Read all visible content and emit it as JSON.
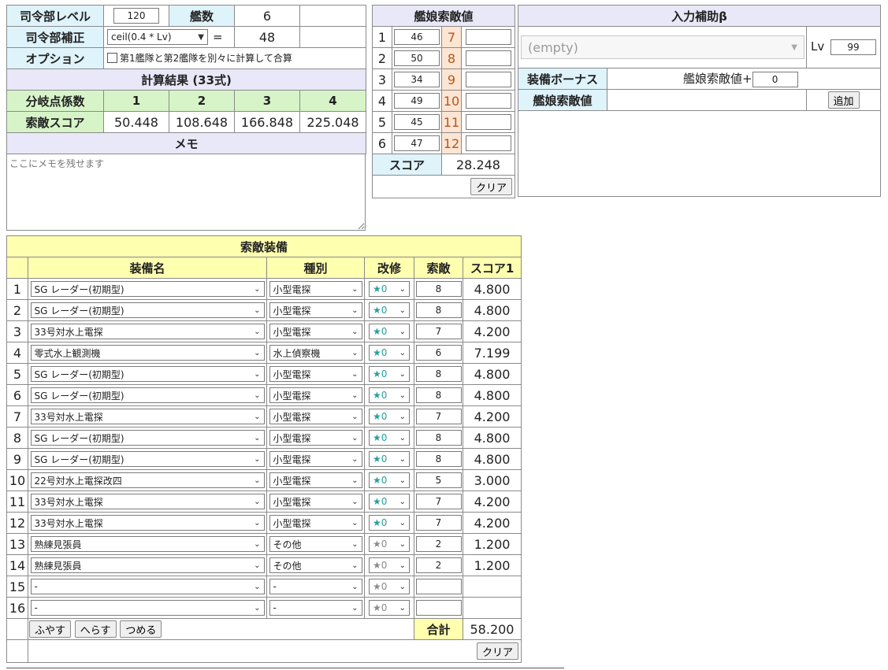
{
  "hq": {
    "level_label": "司令部レベル",
    "level_value": "120",
    "ship_count_label": "艦数",
    "ship_count_value": "6",
    "correction_label": "司令部補正",
    "correction_formula": "ceil(0.4 * Lv)",
    "equals": "=",
    "correction_value": "48",
    "option_label": "オプション",
    "option_text": "第1艦隊と第2艦隊を別々に計算して合算",
    "result_header": "計算結果 (33式)",
    "branch_label": "分岐点係数",
    "branch_values": [
      "1",
      "2",
      "3",
      "4"
    ],
    "score_label": "索敵スコア",
    "score_values": [
      "50.448",
      "108.648",
      "166.848",
      "225.048"
    ],
    "memo_header": "メモ",
    "memo_placeholder": "ここにメモを残せます"
  },
  "ship_los": {
    "header": "艦娘索敵値",
    "left": [
      {
        "n": "1",
        "v": "46"
      },
      {
        "n": "2",
        "v": "50"
      },
      {
        "n": "3",
        "v": "34"
      },
      {
        "n": "4",
        "v": "49"
      },
      {
        "n": "5",
        "v": "45"
      },
      {
        "n": "6",
        "v": "47"
      }
    ],
    "right": [
      {
        "n": "7",
        "v": ""
      },
      {
        "n": "8",
        "v": ""
      },
      {
        "n": "9",
        "v": ""
      },
      {
        "n": "10",
        "v": ""
      },
      {
        "n": "11",
        "v": ""
      },
      {
        "n": "12",
        "v": ""
      }
    ],
    "score_label": "スコア",
    "score_value": "28.248",
    "clear_label": "クリア"
  },
  "assist": {
    "header": "入力補助β",
    "select_value": "(empty)",
    "lv_label": "Lv",
    "lv_value": "99",
    "bonus_label": "装備ボーナス",
    "bonus_text": "艦娘索敵値+",
    "bonus_value": "0",
    "los_label": "艦娘索敵値",
    "add_label": "追加"
  },
  "equip": {
    "header": "索敵装備",
    "columns": [
      "装備名",
      "種別",
      "改修",
      "索敵",
      "スコア1"
    ],
    "rows": [
      {
        "n": "1",
        "name": "SG レーダー(初期型)",
        "type": "小型電探",
        "imp": "★0",
        "on": true,
        "los": "8",
        "score": "4.800"
      },
      {
        "n": "2",
        "name": "SG レーダー(初期型)",
        "type": "小型電探",
        "imp": "★0",
        "on": true,
        "los": "8",
        "score": "4.800"
      },
      {
        "n": "3",
        "name": "33号対水上電探",
        "type": "小型電探",
        "imp": "★0",
        "on": true,
        "los": "7",
        "score": "4.200"
      },
      {
        "n": "4",
        "name": "零式水上観測機",
        "type": "水上偵察機",
        "imp": "★0",
        "on": true,
        "los": "6",
        "score": "7.199"
      },
      {
        "n": "5",
        "name": "SG レーダー(初期型)",
        "type": "小型電探",
        "imp": "★0",
        "on": true,
        "los": "8",
        "score": "4.800"
      },
      {
        "n": "6",
        "name": "SG レーダー(初期型)",
        "type": "小型電探",
        "imp": "★0",
        "on": true,
        "los": "8",
        "score": "4.800"
      },
      {
        "n": "7",
        "name": "33号対水上電探",
        "type": "小型電探",
        "imp": "★0",
        "on": true,
        "los": "7",
        "score": "4.200"
      },
      {
        "n": "8",
        "name": "SG レーダー(初期型)",
        "type": "小型電探",
        "imp": "★0",
        "on": true,
        "los": "8",
        "score": "4.800"
      },
      {
        "n": "9",
        "name": "SG レーダー(初期型)",
        "type": "小型電探",
        "imp": "★0",
        "on": true,
        "los": "8",
        "score": "4.800"
      },
      {
        "n": "10",
        "name": "22号対水上電探改四",
        "type": "小型電探",
        "imp": "★0",
        "on": true,
        "los": "5",
        "score": "3.000"
      },
      {
        "n": "11",
        "name": "33号対水上電探",
        "type": "小型電探",
        "imp": "★0",
        "on": true,
        "los": "7",
        "score": "4.200"
      },
      {
        "n": "12",
        "name": "33号対水上電探",
        "type": "小型電探",
        "imp": "★0",
        "on": true,
        "los": "7",
        "score": "4.200"
      },
      {
        "n": "13",
        "name": "熟練見張員",
        "type": "その他",
        "imp": "★0",
        "on": false,
        "los": "2",
        "score": "1.200"
      },
      {
        "n": "14",
        "name": "熟練見張員",
        "type": "その他",
        "imp": "★0",
        "on": false,
        "los": "2",
        "score": "1.200"
      },
      {
        "n": "15",
        "name": "-",
        "type": "-",
        "imp": "★0",
        "on": false,
        "los": "",
        "score": ""
      },
      {
        "n": "16",
        "name": "-",
        "type": "-",
        "imp": "★0",
        "on": false,
        "los": "",
        "score": ""
      }
    ],
    "btn_add": "ふやす",
    "btn_remove": "へらす",
    "btn_compact": "つめる",
    "total_label": "合計",
    "total_value": "58.200",
    "clear_label": "クリア"
  },
  "colors": {
    "header_bg": "#e8e8f8",
    "cyan_bg": "#dff3fb",
    "green_bg": "#d6f4c8",
    "yellow_bg": "#ffffb0",
    "star_on": "#2a9e9e"
  }
}
